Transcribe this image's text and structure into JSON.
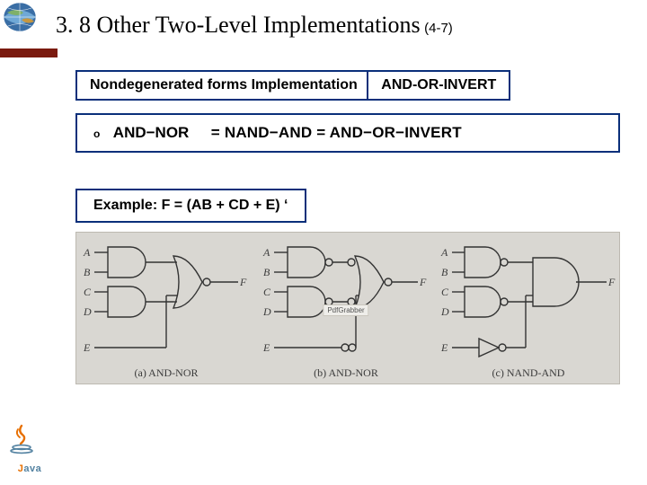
{
  "title": {
    "main": "3. 8 Other Two-Level Implementations",
    "sub": "(4-7)"
  },
  "subtitle": "Nondegenerated forms Implementation",
  "section_label": "AND-OR-INVERT",
  "equation": {
    "lhs": "AND−NOR",
    "rhs": "= NAND−AND = AND−OR−INVERT"
  },
  "example": "Example: F = (AB + CD + E) ‘",
  "figure": {
    "watermark": "PdfGrabber",
    "inputs": {
      "a": "A",
      "b": "B",
      "c": "C",
      "d": "D",
      "e": "E"
    },
    "output": "F",
    "captions": {
      "p1": "(a) AND-NOR",
      "p2": "(b) AND-NOR",
      "p3": "(c) NAND-AND"
    }
  },
  "logos": {
    "java": {
      "j": "J",
      "ava": "ava"
    }
  }
}
